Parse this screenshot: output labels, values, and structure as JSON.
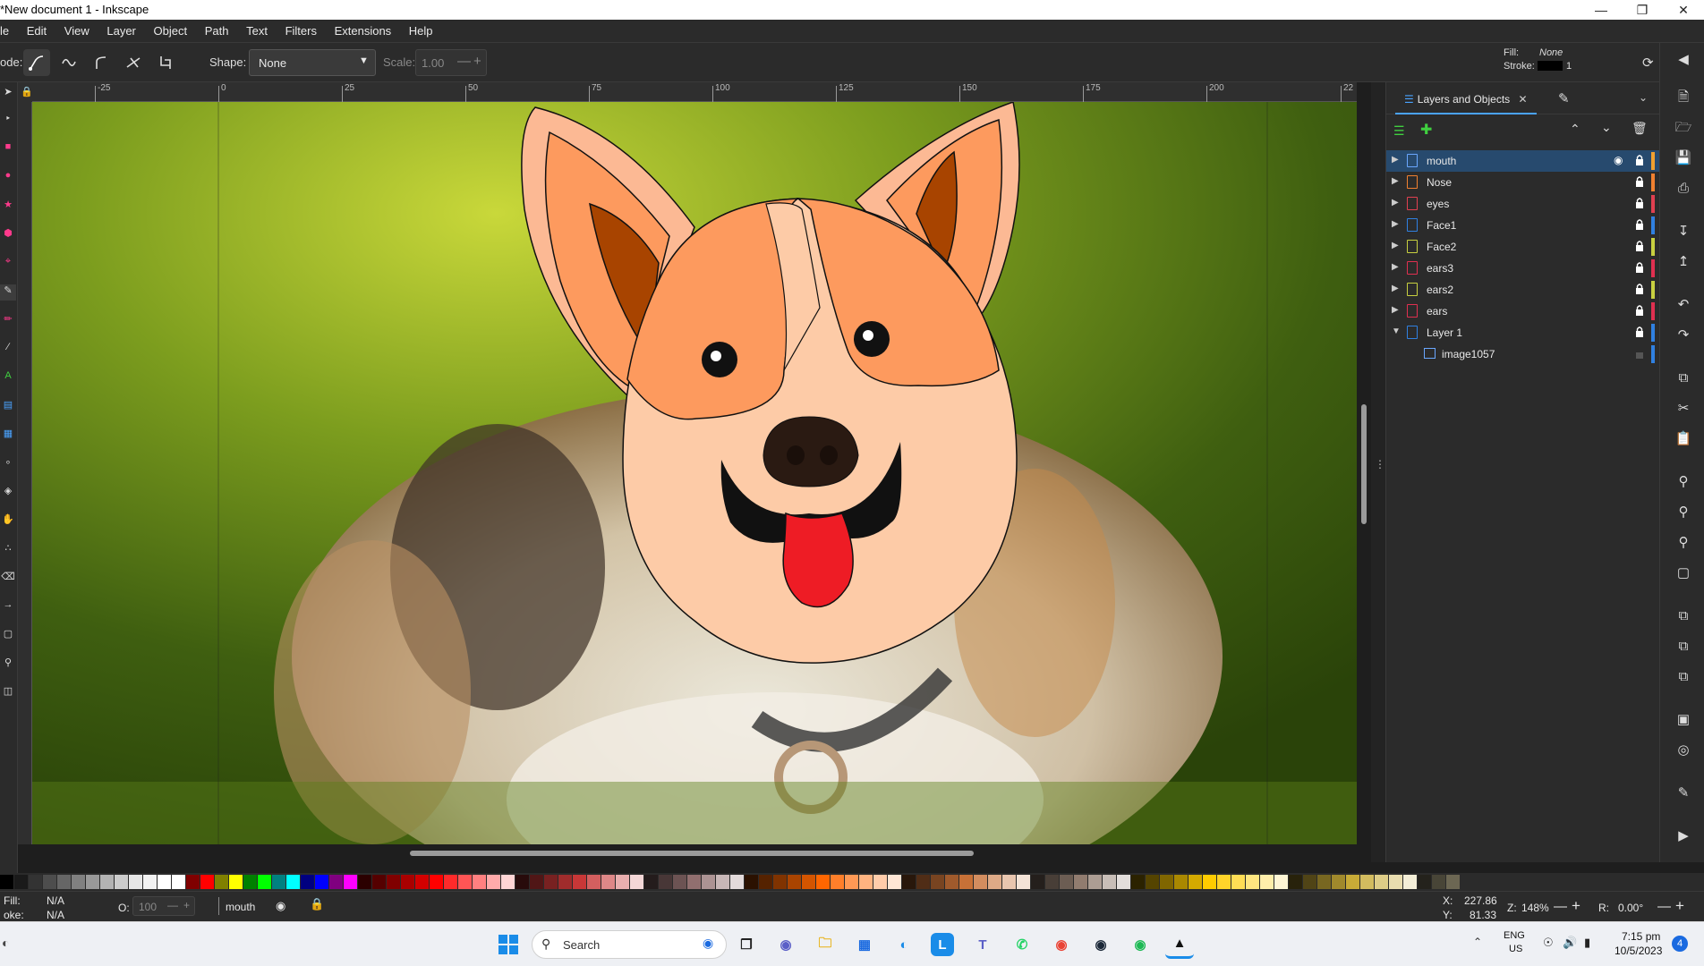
{
  "window": {
    "title": "*New document 1 - Inkscape"
  },
  "menu": [
    "le",
    "Edit",
    "View",
    "Layer",
    "Object",
    "Path",
    "Text",
    "Filters",
    "Extensions",
    "Help"
  ],
  "toolctl": {
    "mode_label": "ode:",
    "shape_label": "Shape:",
    "shape_value": "None",
    "scale_label": "Scale:",
    "scale_value": "1.00",
    "fill_label": "Fill:",
    "fill_value": "None",
    "stroke_label": "Stroke:",
    "stroke_width": "1"
  },
  "ruler": {
    "h_ticks": [
      "-25",
      "0",
      "25",
      "50",
      "75",
      "100",
      "125",
      "150",
      "175",
      "200",
      "22"
    ]
  },
  "panel": {
    "tab_label": "Layers and Objects",
    "layers": [
      {
        "name": "mouth",
        "color": "#f0a030",
        "selected": true
      },
      {
        "name": "Nose",
        "color": "#f08030"
      },
      {
        "name": "eyes",
        "color": "#e04050"
      },
      {
        "name": "Face1",
        "color": "#3080e0"
      },
      {
        "name": "Face2",
        "color": "#c8d040"
      },
      {
        "name": "ears3",
        "color": "#e03050"
      },
      {
        "name": "ears2",
        "color": "#c8d040"
      },
      {
        "name": "ears",
        "color": "#e03050"
      },
      {
        "name": "Layer 1",
        "color": "#3080e0",
        "expanded": true
      }
    ],
    "child": {
      "name": "image1057"
    }
  },
  "status": {
    "fill_label": "Fill:",
    "fill_value": "N/A",
    "stroke_label": "oke:",
    "stroke_value": "N/A",
    "opacity_label": "O:",
    "opacity_value": "100",
    "layer_name": "mouth",
    "x_label": "X:",
    "x_value": "227.86",
    "y_label": "Y:",
    "y_value": "81.33",
    "zoom_label": "Z:",
    "zoom_value": "148%",
    "rot_label": "R:",
    "rot_value": "0.00°"
  },
  "taskbar": {
    "search_placeholder": "Search",
    "lang_top": "ENG",
    "lang_bottom": "US",
    "time": "7:15 pm",
    "date": "10/5/2023",
    "notif_count": "4"
  },
  "palette": [
    "#000000",
    "#1a1a1a",
    "#333333",
    "#4d4d4d",
    "#666666",
    "#808080",
    "#999999",
    "#b3b3b3",
    "#cccccc",
    "#e6e6e6",
    "#f2f2f2",
    "#ffffff",
    "#ffffff",
    "#800000",
    "#ff0000",
    "#808000",
    "#ffff00",
    "#008000",
    "#00ff00",
    "#008080",
    "#00ffff",
    "#000080",
    "#0000ff",
    "#800080",
    "#ff00ff",
    "#2b0000",
    "#550000",
    "#800000",
    "#aa0000",
    "#d40000",
    "#ff0000",
    "#ff2a2a",
    "#ff5555",
    "#ff8080",
    "#ffaaaa",
    "#ffd5d5",
    "#280b0b",
    "#501616",
    "#782121",
    "#a02c2c",
    "#c83737",
    "#d35f5f",
    "#de8787",
    "#e9afaf",
    "#f4d7d7",
    "#241c1c",
    "#483737",
    "#6c5353",
    "#916f6f",
    "#ac9393",
    "#c8b7b7",
    "#e3dbdb",
    "#2b1100",
    "#552200",
    "#803300",
    "#aa4400",
    "#d45500",
    "#ff6600",
    "#ff7f2a",
    "#ff9955",
    "#ffb380",
    "#ffccaa",
    "#ffe6d5",
    "#28170b",
    "#502d16",
    "#784421",
    "#a05a2c",
    "#c87137",
    "#d38d5f",
    "#deaa87",
    "#e9c6af",
    "#f4e3d7",
    "#241f1c",
    "#483e37",
    "#6c5d53",
    "#917c6f",
    "#ac9d93",
    "#c8beb7",
    "#e3dedb",
    "#2b2200",
    "#554400",
    "#806600",
    "#aa8800",
    "#d4aa00",
    "#ffcc00",
    "#ffd42a",
    "#ffdd55",
    "#ffe680",
    "#ffeeaa",
    "#fff6d5",
    "#28220b",
    "#504416",
    "#786721",
    "#a0892c",
    "#c8ab37",
    "#d3bc5f",
    "#decd87",
    "#e9ddaf",
    "#f4eed7",
    "#24221c",
    "#484537",
    "#6c6753"
  ]
}
